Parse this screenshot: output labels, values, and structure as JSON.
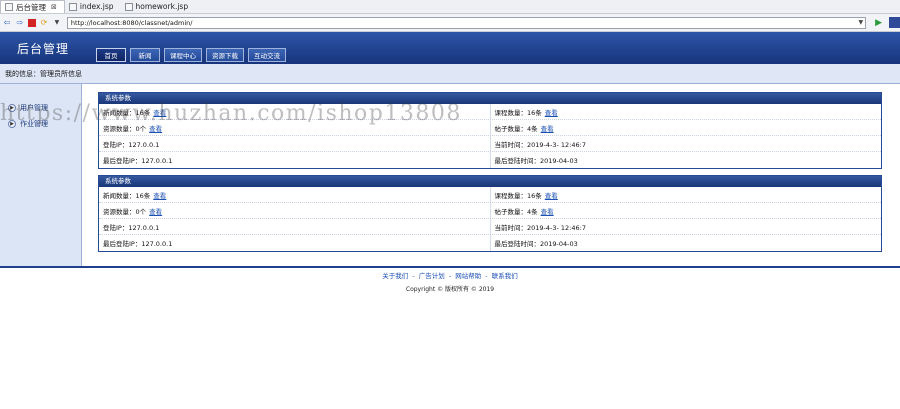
{
  "ide": {
    "tabs": [
      {
        "label": "后台管理",
        "close": "⊠"
      },
      {
        "label": "index.jsp"
      },
      {
        "label": "homework.jsp"
      }
    ]
  },
  "browser": {
    "url": "http://localhost:8080/classnet/admin/"
  },
  "header": {
    "brand": "后台管理",
    "nav": [
      "首页",
      "新闻",
      "课程中心",
      "资源下载",
      "互动交流"
    ]
  },
  "infobar": "我的信息：管理员所信息",
  "sidebar": {
    "items": [
      "用户管理",
      "作业管理"
    ]
  },
  "panels": [
    {
      "title": "系统参数",
      "rows": [
        [
          {
            "label": "新闻数量：16条",
            "link": "查看"
          },
          {
            "label": "课程数量：16条",
            "link": "查看"
          }
        ],
        [
          {
            "label": "资源数量：0个",
            "link": "查看"
          },
          {
            "label": "帖子数量：4条",
            "link": "查看"
          }
        ],
        [
          {
            "label": "登陆IP：127.0.0.1"
          },
          {
            "label": "当前时间：2019-4-3- 12:46:7"
          }
        ],
        [
          {
            "label": "最后登陆IP：127.0.0.1"
          },
          {
            "label": "最后登陆时间：2019-04-03"
          }
        ]
      ]
    },
    {
      "title": "系统参数",
      "rows": [
        [
          {
            "label": "新闻数量：16条",
            "link": "查看"
          },
          {
            "label": "课程数量：16条",
            "link": "查看"
          }
        ],
        [
          {
            "label": "资源数量：0个",
            "link": "查看"
          },
          {
            "label": "帖子数量：4条",
            "link": "查看"
          }
        ],
        [
          {
            "label": "登陆IP：127.0.0.1"
          },
          {
            "label": "当前时间：2019-4-3- 12:46:7"
          }
        ],
        [
          {
            "label": "最后登陆IP：127.0.0.1"
          },
          {
            "label": "最后登陆时间：2019-04-03"
          }
        ]
      ]
    }
  ],
  "footer": {
    "links": [
      "关于我们",
      "广告计划",
      "网站帮助",
      "联系我们"
    ],
    "separator": " - ",
    "copyright": "Copyright © 版权所有 © 2019"
  },
  "watermark": "https://www.huzhan.com/ishop13808"
}
